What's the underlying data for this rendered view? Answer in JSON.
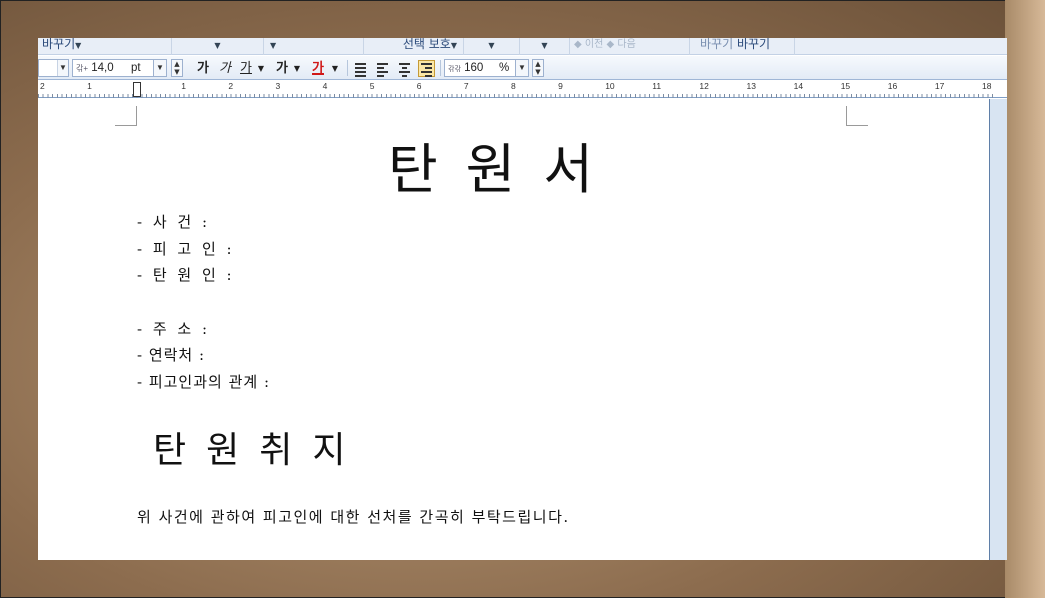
{
  "toolbar_top": {
    "replace_left": "바꾸기",
    "select_protect": "선택 보호",
    "back_label": "이전",
    "next_label": "다음",
    "replace_label_1": "바꾸기",
    "replace_label_2": "바꾸기"
  },
  "toolbar_format": {
    "font_size": "14,0",
    "font_unit": "pt",
    "bold_glyph": "가",
    "italic_glyph": "가",
    "underline_glyph": "가",
    "strike_glyph": "가",
    "color_glyph": "가",
    "line_spacing_value": "160",
    "line_spacing_unit": "%",
    "font_color": "#d01818",
    "active_align": "right"
  },
  "ruler": {
    "labels": [
      "2",
      "1",
      "",
      "1",
      "2",
      "3",
      "4",
      "5",
      "6",
      "7",
      "8",
      "9",
      "10",
      "11",
      "12",
      "13",
      "14",
      "15",
      "16",
      "17",
      "18"
    ]
  },
  "document": {
    "title": "탄원서",
    "fields": [
      "- 사 건 :",
      "- 피 고 인 :",
      "- 탄 원 인 :"
    ],
    "contact": [
      "- 주 소 :",
      "- 연락처 :",
      "- 피고인과의 관계 :"
    ],
    "section_heading": "탄원취지",
    "body_text": "위 사건에 관하여 피고인에 대한 선처를 간곡히 부탁드립니다."
  }
}
